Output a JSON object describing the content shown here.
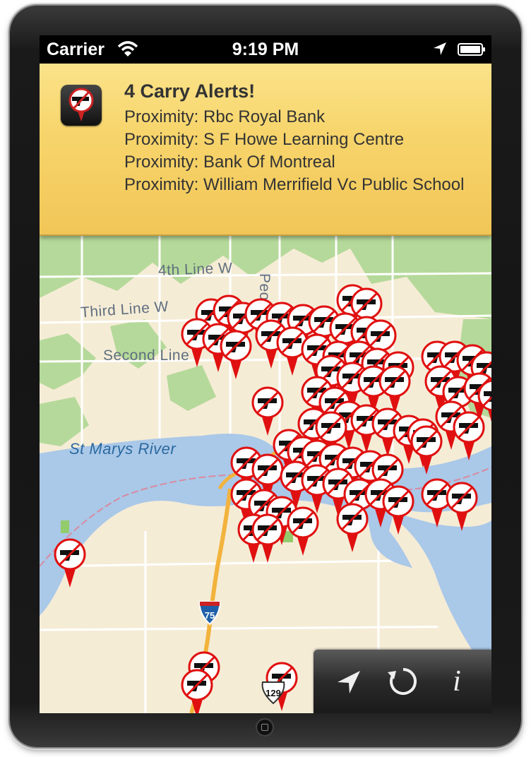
{
  "status_bar": {
    "carrier": "Carrier",
    "time": "9:19 PM"
  },
  "alert": {
    "icon": "gun-pin-icon",
    "title": "4 Carry Alerts!",
    "lines": [
      "Proximity: Rbc Royal Bank",
      "Proximity: S F Howe Learning Centre",
      "Proximity: Bank Of Montreal",
      "Proximity: William Merrifield Vc Public School"
    ]
  },
  "map": {
    "labels": {
      "fourth_line": "4th Line W",
      "third_line": "Third Line W",
      "second_line": "Second Line",
      "river": "St Marys River",
      "peoples": "Peo"
    },
    "shields": {
      "i75": "75",
      "hwy129": "129"
    },
    "colors": {
      "water": "#aac8e8",
      "land": "#f5ecd6",
      "park": "#b5d99a",
      "pin_red": "#e01010"
    }
  },
  "toolbar": {
    "locate_icon": "location-arrow-icon",
    "refresh_icon": "refresh-icon",
    "info_label": "i"
  }
}
